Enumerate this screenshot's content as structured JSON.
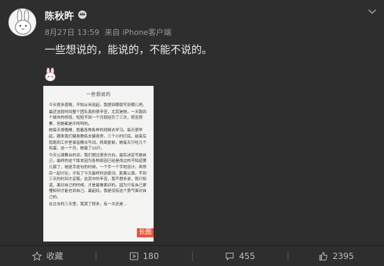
{
  "user": {
    "name": "陈秋旿"
  },
  "meta": {
    "date": "8月27日 13:59",
    "source": "来自 iPhone客户端"
  },
  "post": {
    "text": "一些想说的，能说的，不能不说的。"
  },
  "image": {
    "doc_title": "一些想说的",
    "paragraphs": [
      "今天很多感慨，不知从何说起，我想到哪就写到哪儿吧。",
      "最近这段时间整个团队真的很辛苦，尤其是她，一天跑四个城市的桥段，短短不到一个月就经历了三次，很苦很累，但她都是乐呵呵的。",
      "她每天很晚睡，抱着各种各样的视频去学习。每天很早起，跟来我们健身教练去健身房，三个小时打底，结束后就跑到工作室录音棚去写词。两周复制，她每天只吃几个鸡蛋，这一个月，她瘦了10斤。",
      "今天公演舞台的词，我们想过很多方向，最后决定写她自己。最终的这个版本因为各种原因已经是改过的不知道第几版了，她逐字逐句的时候，一个字一个字地设计，再然后一起讨论，才有了今天最终的这版词。距离公演，不到三天的时间才定稿，这其中的辛苦，我不想多说，我只知道，面对自己的时候，才是最难面对的。因为只有自己更懂知何才能也到自己。最起码，我是没有这个勇气面对自己的。",
      "在过去的三天里，我哭了很多，有一次还是…"
    ],
    "badge": "长图"
  },
  "footer": {
    "favorite_label": "收藏",
    "repost_count": "180",
    "comment_count": "455",
    "like_count": "2395"
  },
  "colors": {
    "background": "#2e2e2e",
    "badge": "#e8563a"
  }
}
